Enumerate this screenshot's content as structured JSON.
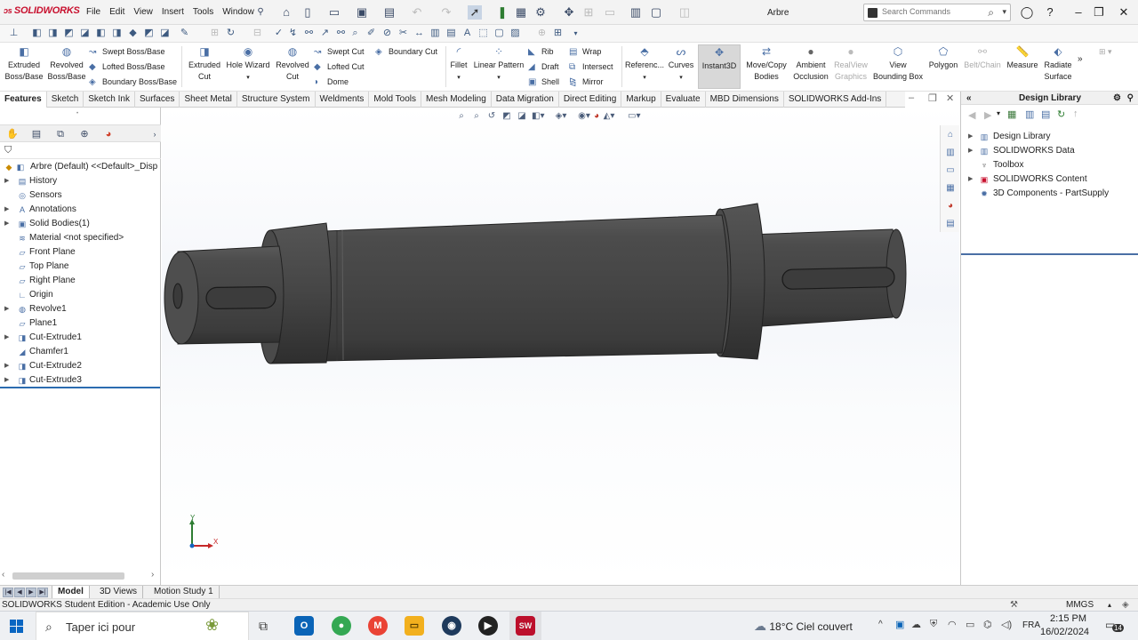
{
  "app": {
    "name": "SOLIDWORKS",
    "document_title": "Arbre",
    "menus": [
      "File",
      "Edit",
      "View",
      "Insert",
      "Tools",
      "Window"
    ],
    "search_placeholder": "Search Commands"
  },
  "ribbon": {
    "features": [
      {
        "label": "Extruded Boss/Base",
        "lines": [
          "Extruded",
          "Boss/Base"
        ],
        "icon": "extruded-boss-icon"
      },
      {
        "label": "Revolved Boss/Base",
        "lines": [
          "Revolved",
          "Boss/Base"
        ],
        "icon": "revolved-boss-icon"
      },
      {
        "label": "Swept Boss/Base",
        "icon": "swept-boss-icon"
      },
      {
        "label": "Lofted Boss/Base",
        "icon": "lofted-boss-icon"
      },
      {
        "label": "Boundary Boss/Base",
        "icon": "boundary-boss-icon"
      },
      {
        "label": "Extruded Cut",
        "lines": [
          "Extruded",
          "Cut"
        ],
        "icon": "extruded-cut-icon"
      },
      {
        "label": "Hole Wizard",
        "icon": "hole-wizard-icon"
      },
      {
        "label": "Revolved Cut",
        "lines": [
          "Revolved",
          "Cut"
        ],
        "icon": "revolved-cut-icon"
      },
      {
        "label": "Swept Cut",
        "icon": "swept-cut-icon"
      },
      {
        "label": "Lofted Cut",
        "icon": "lofted-cut-icon"
      },
      {
        "label": "Dome",
        "icon": "dome-icon"
      },
      {
        "label": "Boundary Cut",
        "icon": "boundary-cut-icon"
      },
      {
        "label": "Fillet",
        "icon": "fillet-icon"
      },
      {
        "label": "Linear Pattern",
        "icon": "linear-pattern-icon"
      },
      {
        "label": "Rib",
        "icon": "rib-icon"
      },
      {
        "label": "Draft",
        "icon": "draft-icon"
      },
      {
        "label": "Shell",
        "icon": "shell-icon"
      },
      {
        "label": "Wrap",
        "icon": "wrap-icon"
      },
      {
        "label": "Intersect",
        "icon": "intersect-icon"
      },
      {
        "label": "Mirror",
        "icon": "mirror-icon"
      },
      {
        "label": "Referenc...",
        "icon": "reference-geometry-icon"
      },
      {
        "label": "Curves",
        "icon": "curves-icon"
      },
      {
        "label": "Instant3D",
        "icon": "instant3d-icon"
      },
      {
        "label": "Move/Copy Bodies",
        "lines": [
          "Move/Copy",
          "Bodies"
        ],
        "icon": "move-copy-icon"
      },
      {
        "label": "Ambient Occlusion",
        "lines": [
          "Ambient",
          "Occlusion"
        ],
        "icon": "ambient-occlusion-icon"
      },
      {
        "label": "RealView Graphics",
        "lines": [
          "RealView",
          "Graphics"
        ],
        "icon": "realview-icon"
      },
      {
        "label": "View Bounding Box",
        "lines": [
          "View",
          "Bounding Box"
        ],
        "icon": "bounding-box-icon"
      },
      {
        "label": "Polygon",
        "icon": "polygon-icon"
      },
      {
        "label": "Belt/Chain",
        "icon": "belt-chain-icon"
      },
      {
        "label": "Measure",
        "icon": "measure-icon"
      },
      {
        "label": "Radiate Surface",
        "lines": [
          "Radiate",
          "Surface"
        ],
        "icon": "radiate-surface-icon"
      }
    ]
  },
  "command_tabs": [
    "Features",
    "Sketch",
    "Sketch Ink",
    "Surfaces",
    "Sheet Metal",
    "Structure System",
    "Weldments",
    "Mold Tools",
    "Mesh Modeling",
    "Data Migration",
    "Direct Editing",
    "Markup",
    "Evaluate",
    "MBD Dimensions",
    "SOLIDWORKS Add-Ins"
  ],
  "feature_tree": {
    "root": "Arbre (Default) <<Default>_Disp",
    "items": [
      {
        "label": "History",
        "icon": "history-icon",
        "expandable": true
      },
      {
        "label": "Sensors",
        "icon": "sensors-icon",
        "expandable": false
      },
      {
        "label": "Annotations",
        "icon": "annotations-icon",
        "expandable": true
      },
      {
        "label": "Solid Bodies(1)",
        "icon": "solid-bodies-icon",
        "expandable": true
      },
      {
        "label": "Material <not specified>",
        "icon": "material-icon",
        "expandable": false
      },
      {
        "label": "Front Plane",
        "icon": "plane-icon",
        "expandable": false
      },
      {
        "label": "Top Plane",
        "icon": "plane-icon",
        "expandable": false
      },
      {
        "label": "Right Plane",
        "icon": "plane-icon",
        "expandable": false
      },
      {
        "label": "Origin",
        "icon": "origin-icon",
        "expandable": false
      },
      {
        "label": "Revolve1",
        "icon": "revolve-icon",
        "expandable": true
      },
      {
        "label": "Plane1",
        "icon": "plane-icon",
        "expandable": false
      },
      {
        "label": "Cut-Extrude1",
        "icon": "cut-extrude-icon",
        "expandable": true
      },
      {
        "label": "Chamfer1",
        "icon": "chamfer-icon",
        "expandable": false
      },
      {
        "label": "Cut-Extrude2",
        "icon": "cut-extrude-icon",
        "expandable": true
      },
      {
        "label": "Cut-Extrude3",
        "icon": "cut-extrude-icon",
        "expandable": true
      }
    ]
  },
  "design_library": {
    "title": "Design Library",
    "items": [
      {
        "label": "Design Library",
        "icon": "library-icon",
        "expandable": true
      },
      {
        "label": "SOLIDWORKS Data",
        "icon": "data-icon",
        "expandable": true
      },
      {
        "label": "Toolbox",
        "icon": "toolbox-icon",
        "expandable": false
      },
      {
        "label": "SOLIDWORKS Content",
        "icon": "content-icon",
        "expandable": true
      },
      {
        "label": "3D Components - PartSupply",
        "icon": "partsupply-icon",
        "expandable": false
      }
    ]
  },
  "triad": {
    "y": "Y",
    "x": "X"
  },
  "bottom_tabs": [
    "Model",
    "3D Views",
    "Motion Study 1"
  ],
  "status": {
    "left": "SOLIDWORKS Student Edition - Academic Use Only",
    "units": "MMGS"
  },
  "taskbar": {
    "search_placeholder": "Taper ici pour",
    "weather": "18°C  Ciel couvert",
    "language": "FRA",
    "time": "2:15 PM",
    "date": "16/02/2024",
    "notification_count": "14"
  },
  "colors": {
    "accent": "#c8102e",
    "selection": "#2b6cb0",
    "part": "#4a4a4a"
  }
}
